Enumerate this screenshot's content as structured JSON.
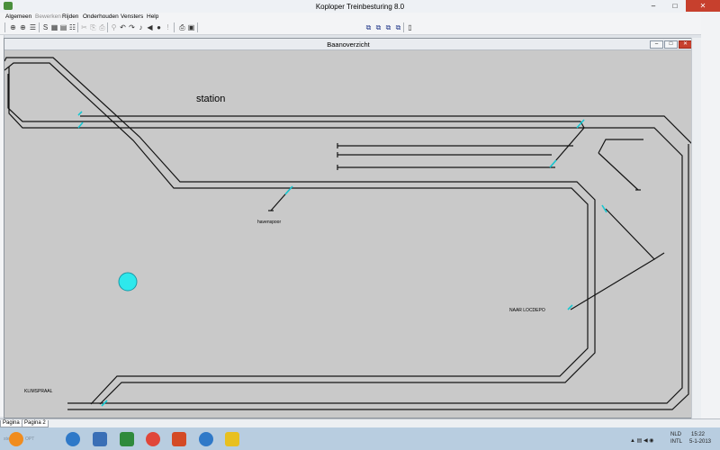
{
  "window": {
    "title": "Koploper Treinbesturing 8.0",
    "minimize": "–",
    "maximize": "□",
    "close": "✕"
  },
  "menu": [
    {
      "label": "Algemeen",
      "enabled": true
    },
    {
      "label": "Bewerken",
      "enabled": false
    },
    {
      "label": "Rijden",
      "enabled": true
    },
    {
      "label": "Onderhouden",
      "enabled": true
    },
    {
      "label": "Vensters",
      "enabled": true
    },
    {
      "label": "Help",
      "enabled": true
    }
  ],
  "toolbar": {
    "icons": [
      "locomotive-icon",
      "signal-icon",
      "block-icon",
      "s-icon",
      "grid-icon",
      "grid2-icon",
      "list-icon",
      "cut-icon",
      "copy-icon",
      "paste-icon",
      "filter-icon",
      "undo-icon",
      "redo-icon",
      "sound-icon",
      "speaker-icon",
      "stop-icon",
      "light-icon",
      "print-icon",
      "export-icon",
      "tile-icon",
      "cascade-icon",
      "arrange-icon",
      "arrange2-icon",
      "page-icon"
    ],
    "glyphs": [
      "▮",
      "⊕",
      "⊕",
      "☰",
      "S",
      "▦",
      "▤",
      "☷",
      "✂",
      "⎘",
      "⎙",
      "⚲",
      "↶",
      "↷",
      "♪",
      "◀",
      "●",
      "!",
      "⎙",
      "▣",
      "⧉",
      "⧉",
      "⧉",
      "⧉",
      "▯"
    ]
  },
  "child_window": {
    "title": "Baanoverzicht",
    "minimize": "–",
    "maximize": "□",
    "close": "✕"
  },
  "layout": {
    "labels": {
      "station": "station",
      "havenspoor": "havenspoor",
      "naar_locdepo": "NAAR LOCDEPO",
      "klimspraal": "KLIMSPRAAL"
    },
    "colors": {
      "track": "#141414",
      "turnout": "#16c8d2",
      "background": "#c9c9c9",
      "marker": "#2ee8ec"
    }
  },
  "tabs": [
    "Pagina 1",
    "Pagina 2"
  ],
  "taskbar": {
    "ghost_text": [
      "ste",
      "OPT"
    ],
    "tray": {
      "lang_top": "NLD",
      "lang_bottom": "INTL",
      "time": "15:22",
      "date": "5-1-2013"
    }
  }
}
